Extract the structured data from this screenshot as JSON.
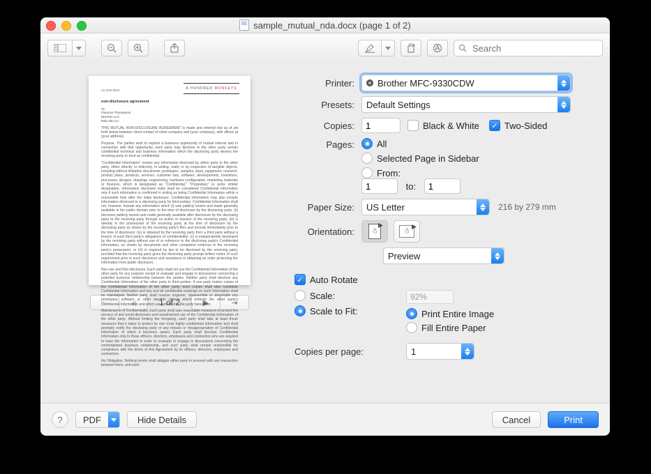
{
  "window": {
    "title": "sample_mutual_nda.docx (page 1 of 2)"
  },
  "toolbar": {
    "search_placeholder": "Search"
  },
  "preview": {
    "page_label": "1 of 2"
  },
  "doc": {
    "date": "10 JUN 2019",
    "heading": "non-disclosure agreement",
    "intro": "THIS MUTUAL NON-DISCLOSURE AGREEMENT is made and entered into as of set forth below between client contact of client company and (your company), with offices at (your address).",
    "p1": "Purpose. The parties wish to explore a business opportunity of mutual interest and in connection with that opportunity, each party may disclose to the other party certain confidential technical and business information which the disclosing party desires the receiving party to treat as confidential.",
    "p2": "\"Confidential Information\" means any information disclosed by either party to the other party, either directly or indirectly, in writing, orally or by inspection of tangible objects, including without limitation documents, prototypes, samples, plant, equipment, research, product plans, products, services, customer lists, software, developments, inventions, processes, designs, drawings, engineering, hardware configuration, marketing materials or finances, which is designated as \"Confidential,\" \"Proprietary\" or some similar designation. Information disclosed orally shall be considered Confidential Information only if such information is confirmed in writing as being Confidential Information within a reasonable time after the initial disclosure. Confidential Information may also include information disclosed to a disclosing party by third parties. Confidential Information shall not, however, include any information which (i) was publicly known and made generally available in the public domain prior to the time of disclosure by the disclosing party; (ii) becomes publicly known and made generally available after disclosure by the disclosing party to the receiving party through no action or inaction of the receiving party; (iii) is already in the possession of the receiving party at the time of disclosure by the disclosing party as shown by the receiving party's files and records immediately prior to the time of disclosure; (iv) is obtained by the receiving party from a third party without a breach of such third party's obligations of confidentiality; (v) is independently developed by the receiving party without use of or reference to the disclosing party's Confidential Information, as shown by documents and other competent evidence in the receiving party's possession; or (vi) is required by law to be disclosed by the receiving party, provided that the receiving party gives the disclosing party prompt written notice of such requirement prior to such disclosure and assistance in obtaining an order protecting the information from public disclosure.",
    "p3": "Non-use and Non-disclosure. Each party shall not use the Confidential Information of the other party for any purpose except to evaluate and engage in discussions concerning a potential business relationship between the parties. Neither party shall disclose any Confidential Information of the other party to third parties. If one party makes copies of the Confidential Information of the other party, such copies shall also constitute Confidential Information and any and all confidential markings on such Information shall be maintained. Neither party shall reverse engineer, disassemble or decompile any prototypes, software or other tangible objects which embody the other party's Confidential Information and which are provided to the party hereunder.",
    "p4": "Maintenance of Confidentiality. Each party shall take reasonable measures to protect the secrecy of and avoid disclosure and unauthorized use of the Confidential Information of the other party. Without limiting the foregoing, each party shall take at least those measures that it takes to protect its own most highly confidential information and shall promptly notify the disclosing party of any misuse or misappropriation of Confidential Information of which it becomes aware. Each party shall disclose Confidential Information only to those officers, directors, employees and contractors who are required to have the information in order to evaluate or engage in discussions concerning the contemplated business relationship, and such party shall remain responsible for compliance with the terms of this Agreement by its officers, directors, employees and contractors.",
    "p5": "No Obligation. Nothing herein shall obligate either party to proceed with any transaction between them, and each"
  },
  "form": {
    "printer": {
      "label": "Printer:",
      "value": "Brother MFC-9330CDW"
    },
    "presets": {
      "label": "Presets:",
      "value": "Default Settings"
    },
    "copies": {
      "label": "Copies:",
      "value": "1",
      "bw_label": "Black & White",
      "twosided_label": "Two-Sided",
      "bw_checked": false,
      "twosided_checked": true
    },
    "pages": {
      "label": "Pages:",
      "all": "All",
      "selected": "Selected Page in Sidebar",
      "from_label": "From:",
      "to_label": "to:",
      "from": "1",
      "to": "1",
      "choice": "all"
    },
    "paper": {
      "label": "Paper Size:",
      "value": "US Letter",
      "hint": "216 by ­279 mm"
    },
    "orientation": {
      "label": "Orientation:",
      "value": "portrait"
    },
    "app_select": {
      "value": "Preview"
    },
    "auto_rotate": "Auto Rotate",
    "scale": {
      "scale_label": "Scale:",
      "fit_label": "Scale to Fit:",
      "value": "92%",
      "choice": "fit",
      "print_entire": "Print Entire Image",
      "fill_paper": "Fill Entire Paper",
      "fit_choice": "print_entire"
    },
    "copies_per_page": {
      "label": "Copies per page:",
      "value": "1"
    }
  },
  "footer": {
    "pdf": "PDF",
    "hide_details": "Hide Details",
    "cancel": "Cancel",
    "print": "Print"
  }
}
